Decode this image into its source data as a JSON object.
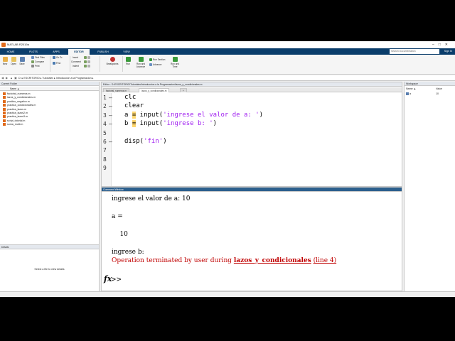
{
  "window": {
    "title": "MATLAB R2019a"
  },
  "tabs": [
    {
      "label": "HOME"
    },
    {
      "label": "PLOTS"
    },
    {
      "label": "APPS"
    },
    {
      "label": "EDITOR",
      "active": true
    },
    {
      "label": "PUBLISH"
    },
    {
      "label": "VIEW"
    }
  ],
  "search": {
    "placeholder": "Search Documentation"
  },
  "signin": "Sign In",
  "ribbon": {
    "new": "New",
    "open": "Open",
    "save": "Save",
    "find_files": "Find Files",
    "compare": "Compare",
    "print": "Print",
    "insert": "Insert",
    "comment": "Comment",
    "indent": "Indent",
    "goto": "Go To",
    "find": "Find",
    "breakpoints": "Breakpoints",
    "run": "Run",
    "run_advance": "Run and Advance",
    "run_section": "Run Section",
    "advance": "Advance",
    "run_time": "Run and Time",
    "groups": {
      "file": "FILE",
      "navigate": "NAVIGATE",
      "edit": "EDIT",
      "breakpoints": "BREAKPOINTS",
      "run": "RUN"
    }
  },
  "address": {
    "path": "D: ▸ ESCRITORIO ▸ Tutoriales ▸ Introduccion a la Programacion ▸"
  },
  "current_folder": {
    "title": "Current Folder",
    "column": "Name ▲",
    "files": [
      "factorial_numeros.m",
      "lazos_y_condicionales.m",
      "positivo_negativo.m",
      "practica_condicionales.m",
      "practica_lazos.m",
      "practica_lazos2.m",
      "practica_lazos3.m",
      "script_tutorial.m",
      "suma_multi.m"
    ]
  },
  "details": {
    "title": "Details",
    "message": "Select a file to view details"
  },
  "editor": {
    "title": "Editor - D:\\ESCRITORIO\\Tutoriales\\Introduccion a la Programacion\\lazos_y_condicionales.m",
    "tabs": [
      "factorial_numeros.m",
      "lazos_y_condicionales.m",
      "+"
    ],
    "lines": [
      {
        "num": "1",
        "bullet": "—",
        "code": "clc"
      },
      {
        "num": "2",
        "bullet": "—",
        "code": "clear"
      },
      {
        "num": "3",
        "bullet": "—",
        "lhs": "a",
        "eq": "=",
        "fn": " input(",
        "str": "'ingrese el valor de a: '",
        "close": ")"
      },
      {
        "num": "4",
        "bullet": "—",
        "lhs": "b",
        "eq": "=",
        "fn": " input(",
        "str": "'ingrese b: '",
        "close": ")"
      },
      {
        "num": "5",
        "bullet": "",
        "code": ""
      },
      {
        "num": "6",
        "bullet": "—",
        "fn": "disp(",
        "str": "'fin'",
        "close": ")"
      },
      {
        "num": "7",
        "bullet": "",
        "code": ""
      },
      {
        "num": "8",
        "bullet": "",
        "code": ""
      },
      {
        "num": "9",
        "bullet": "",
        "code": ""
      }
    ]
  },
  "command_window": {
    "title": "Command Window",
    "lines": [
      "ingrese el valor de a: 10",
      "a =",
      "    10",
      "ingrese b:"
    ],
    "error_prefix": "Operation terminated by user during ",
    "error_link": "lazos_y_condicionales",
    "error_line": "(line 4)",
    "fx": "fx",
    "prompt": ">>"
  },
  "workspace": {
    "title": "Workspace",
    "columns": [
      "Name ▲",
      "Value"
    ],
    "vars": [
      {
        "name": "a",
        "value": "10"
      }
    ]
  },
  "colors": {
    "accent": "#0a3d6b",
    "error": "#c00000",
    "string": "#a020f0"
  }
}
